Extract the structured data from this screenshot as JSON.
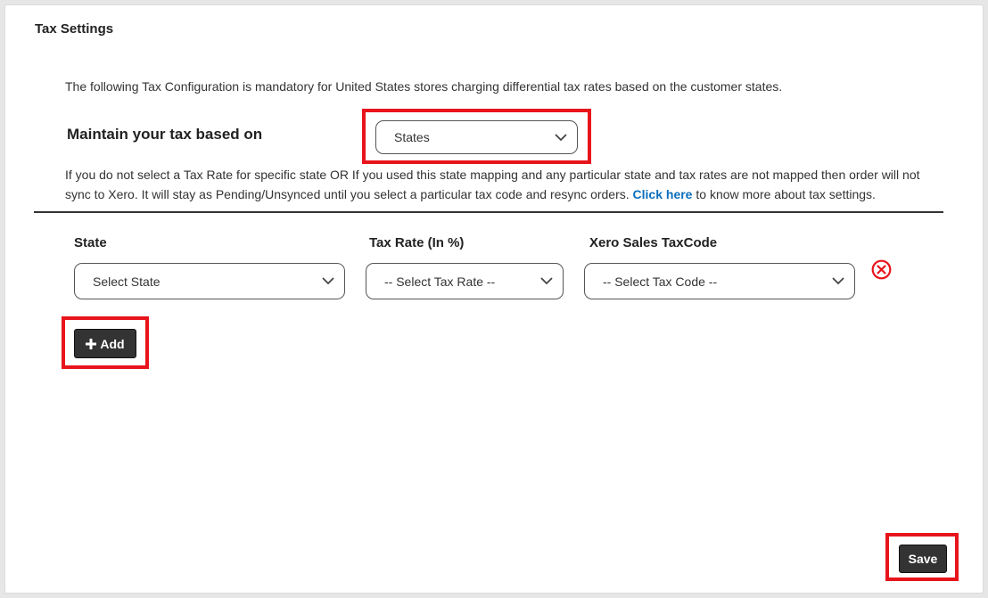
{
  "section": {
    "title": "Tax Settings",
    "intro": "The following Tax Configuration is mandatory for United States stores charging differential tax rates based on the customer states."
  },
  "maintain": {
    "label": "Maintain your tax based on",
    "selected": "States"
  },
  "note": {
    "before_link": "If you do not select a Tax Rate for specific state OR If you used this state mapping and any particular state and tax rates are not mapped then order will not sync to Xero. It will stay as Pending/Unsynced until you select a particular tax code and resync orders. ",
    "link": "Click here",
    "after_link": " to know more about tax settings."
  },
  "columns": {
    "state": "State",
    "tax_rate": "Tax Rate (In %)",
    "xero_code": "Xero Sales TaxCode"
  },
  "row": {
    "state_value": "Select State",
    "tax_rate_value": "-- Select Tax Rate --",
    "tax_code_value": "-- Select Tax Code --"
  },
  "buttons": {
    "add": "Add",
    "save": "Save"
  },
  "colors": {
    "highlight": "#e8141b",
    "button_bg": "#333333",
    "link": "#0a6ebd",
    "remove_icon": "#e8141b"
  }
}
